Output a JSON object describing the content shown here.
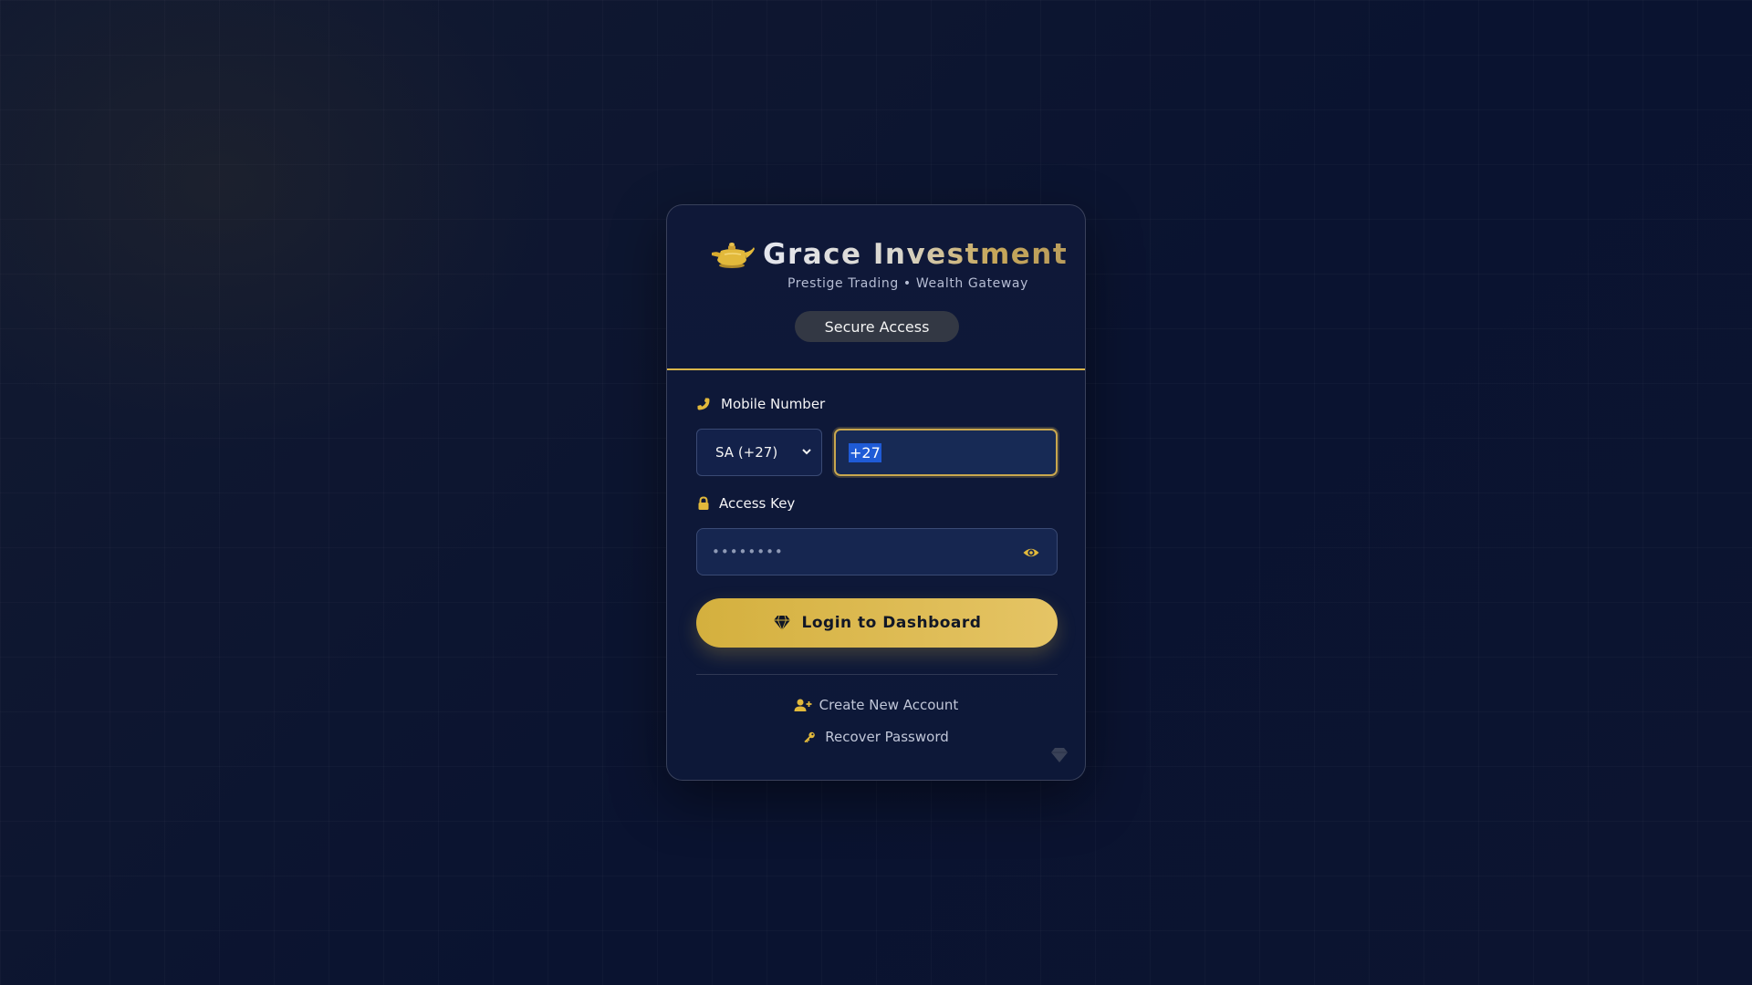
{
  "brand": {
    "title": "Grace Investment",
    "tagline": "Prestige Trading • Wealth Gateway",
    "badge": "Secure Access",
    "logo_icon": "oil-lamp-icon"
  },
  "form": {
    "mobile_label": "Mobile Number",
    "country_selected": "SA (+27)",
    "phone_value": "+27",
    "access_label": "Access Key",
    "password_mask": "••••••••",
    "login_label": "Login to Dashboard"
  },
  "links": {
    "create_account": "Create New Account",
    "recover_password": "Recover Password"
  },
  "colors": {
    "accent_gold": "#d4b03e",
    "background": "#0b1330",
    "card": "#0f1838"
  }
}
